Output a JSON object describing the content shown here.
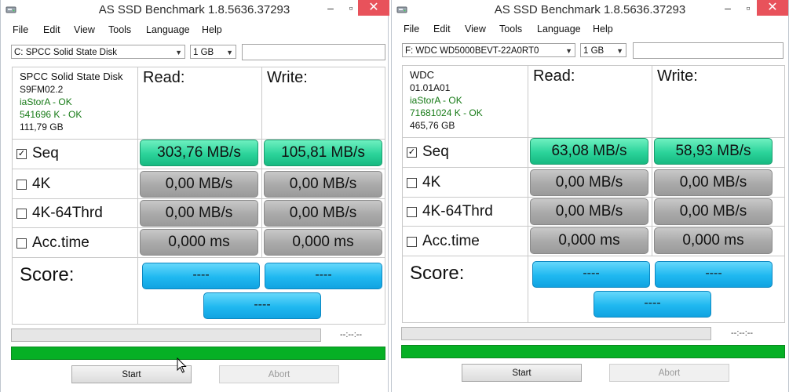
{
  "windows": [
    {
      "title": "AS SSD Benchmark 1.8.5636.37293",
      "menu": [
        "File",
        "Edit",
        "View",
        "Tools",
        "Language",
        "Help"
      ],
      "drive_select": "C: SPCC Solid State Disk",
      "size_select": "1 GB",
      "info": {
        "name": "SPCC Solid State Disk",
        "firmware": "S9FM02.2",
        "driver": "iaStorA - OK",
        "alignment": "541696 K - OK",
        "capacity": "111,79 GB"
      },
      "read_header": "Read:",
      "write_header": "Write:",
      "rows": [
        {
          "label": "Seq",
          "checked": true,
          "read": "303,76 MB/s",
          "write": "105,81 MB/s"
        },
        {
          "label": "4K",
          "checked": false,
          "read": "0,00 MB/s",
          "write": "0,00 MB/s"
        },
        {
          "label": "4K-64Thrd",
          "checked": false,
          "read": "0,00 MB/s",
          "write": "0,00 MB/s"
        },
        {
          "label": "Acc.time",
          "checked": false,
          "read": "0,000 ms",
          "write": "0,000 ms"
        }
      ],
      "score_label": "Score:",
      "score_read": "----",
      "score_write": "----",
      "score_total": "----",
      "time": "--:--:--",
      "start_label": "Start",
      "abort_label": "Abort"
    },
    {
      "title": "AS SSD Benchmark 1.8.5636.37293",
      "menu": [
        "File",
        "Edit",
        "View",
        "Tools",
        "Language",
        "Help"
      ],
      "drive_select": "F: WDC WD5000BEVT-22A0RT0",
      "size_select": "1 GB",
      "info": {
        "name": "WDC",
        "firmware": "01.01A01",
        "driver": "iaStorA - OK",
        "alignment": "71681024 K - OK",
        "capacity": "465,76 GB"
      },
      "read_header": "Read:",
      "write_header": "Write:",
      "rows": [
        {
          "label": "Seq",
          "checked": true,
          "read": "63,08 MB/s",
          "write": "58,93 MB/s"
        },
        {
          "label": "4K",
          "checked": false,
          "read": "0,00 MB/s",
          "write": "0,00 MB/s"
        },
        {
          "label": "4K-64Thrd",
          "checked": false,
          "read": "0,00 MB/s",
          "write": "0,00 MB/s"
        },
        {
          "label": "Acc.time",
          "checked": false,
          "read": "0,000 ms",
          "write": "0,000 ms"
        }
      ],
      "score_label": "Score:",
      "score_read": "----",
      "score_write": "----",
      "score_total": "----",
      "time": "--:--:--",
      "start_label": "Start",
      "abort_label": "Abort"
    }
  ],
  "colors": {
    "seq_highlight": "#2bd39a",
    "score_blue": "#1fb8f0",
    "progress_green": "#06b025",
    "close_red": "#e8525b"
  }
}
